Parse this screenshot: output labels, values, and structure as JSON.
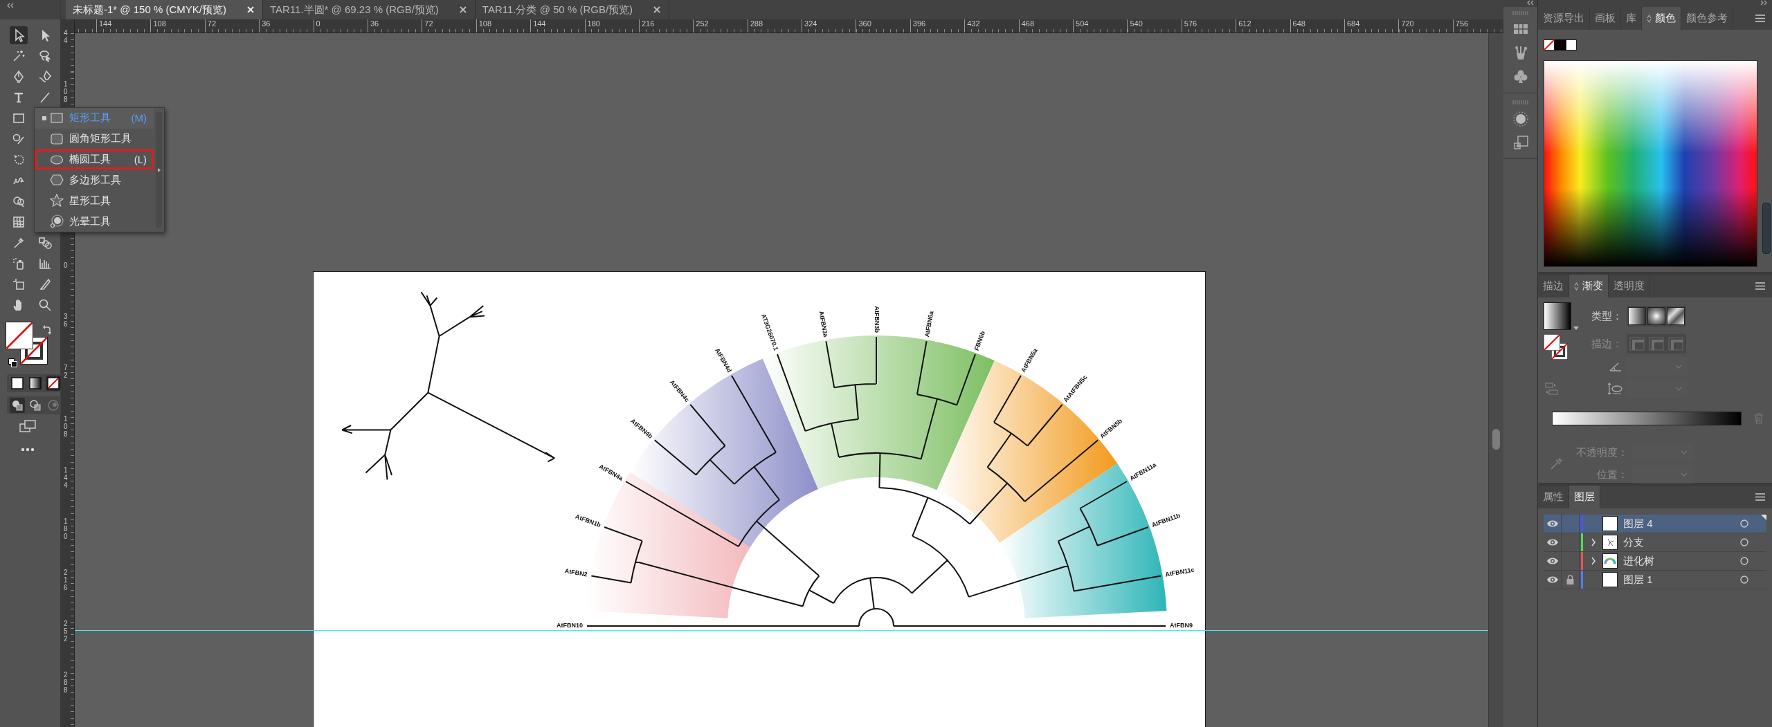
{
  "doc_tabs": [
    {
      "title": "未标题-1* @ 150 % (CMYK/预览)",
      "selected": true
    },
    {
      "title": "TAR11.半圆* @ 69.23 % (RGB/预览)",
      "selected": false
    },
    {
      "title": "TAR11.分类 @ 50 % (RGB/预览)",
      "selected": false
    }
  ],
  "rulers": {
    "horizontal": [
      "144",
      "108",
      "72",
      "36",
      "0",
      "36",
      "72",
      "108",
      "144",
      "180",
      "216",
      "252",
      "288",
      "324",
      "360",
      "396",
      "432",
      "468",
      "504",
      "540",
      "576",
      "612",
      "648",
      "684",
      "720",
      "756"
    ],
    "vertical_above": [
      "44",
      "108"
    ],
    "vertical": [
      "0",
      "36",
      "72",
      "108",
      "144",
      "180",
      "216",
      "252",
      "288"
    ]
  },
  "toolbar": {
    "tool_rows": [
      [
        {
          "kind": "selection",
          "selected": true
        },
        {
          "kind": "direct-selection",
          "selected": false
        }
      ],
      [
        {
          "kind": "magic-wand",
          "selected": false
        },
        {
          "kind": "lasso",
          "selected": false
        }
      ],
      [
        {
          "kind": "pen",
          "selected": false
        },
        {
          "kind": "curvature",
          "selected": false
        }
      ],
      [
        {
          "kind": "type",
          "selected": false
        },
        {
          "kind": "line",
          "selected": false
        }
      ],
      [
        {
          "kind": "rectangle",
          "selected": false
        }
      ],
      [
        {
          "kind": "shaper",
          "selected": false
        }
      ],
      [
        {
          "kind": "rotate",
          "selected": false
        }
      ],
      [
        {
          "kind": "puppet-warp",
          "selected": false
        }
      ],
      [
        {
          "kind": "shape-builder",
          "selected": false
        }
      ],
      [
        {
          "kind": "mesh",
          "selected": false
        }
      ],
      [
        {
          "kind": "eyedropper",
          "selected": false
        },
        {
          "kind": "blend",
          "selected": false
        }
      ],
      [
        {
          "kind": "symbol-sprayer",
          "selected": false
        },
        {
          "kind": "graph",
          "selected": false
        }
      ],
      [
        {
          "kind": "artboard",
          "selected": false
        },
        {
          "kind": "slice",
          "selected": false
        }
      ],
      [
        {
          "kind": "hand",
          "selected": false
        },
        {
          "kind": "zoom",
          "selected": false
        }
      ]
    ],
    "fill_modes": [
      {
        "kind": "color",
        "selected": false
      },
      {
        "kind": "gradient",
        "selected": false
      },
      {
        "kind": "none",
        "selected": true
      }
    ],
    "draw_modes": [
      {
        "kind": "normal",
        "selected": true
      },
      {
        "kind": "behind",
        "selected": false
      },
      {
        "kind": "inside",
        "selected": false
      }
    ]
  },
  "flyout": {
    "items": [
      {
        "kind": "rectangle",
        "label": "矩形工具",
        "shortcut": "(M)",
        "selected": true,
        "highlighted": false
      },
      {
        "kind": "rounded-rectangle",
        "label": "圆角矩形工具",
        "selected": false,
        "highlighted": false
      },
      {
        "kind": "ellipse",
        "label": "椭圆工具",
        "shortcut": "(L)",
        "selected": false,
        "highlighted": true
      },
      {
        "kind": "polygon",
        "label": "多边形工具",
        "selected": false,
        "highlighted": false
      },
      {
        "kind": "star",
        "label": "星形工具",
        "selected": false,
        "highlighted": false
      },
      {
        "kind": "flare",
        "label": "光晕工具",
        "selected": false,
        "highlighted": false
      }
    ]
  },
  "tree": {
    "leaves": [
      "AtFBN10",
      "AtFBN2",
      "AtFBN1b",
      "AtFBN4a",
      "AtFBN4b",
      "AtFBN4c",
      "AtFBN4d",
      "AT3G26070.1",
      "AtFBN3a",
      "AtFBN3b",
      "AtFBN6a",
      "FBN6b",
      "AtFBN5a",
      "AtAtFBN5c",
      "AtFBN5b",
      "AtFBN11a",
      "AtFBN11b",
      "AtFBN11c",
      "AtFBN9"
    ]
  },
  "color_panel": {
    "tabs": [
      {
        "label": "资源导出",
        "selected": false
      },
      {
        "label": "画板",
        "selected": false
      },
      {
        "label": "库",
        "selected": false
      },
      {
        "label": "颜色",
        "selected": true
      },
      {
        "label": "颜色参考",
        "selected": false
      }
    ]
  },
  "gradient_panel": {
    "tabs": [
      {
        "label": "描边",
        "selected": false
      },
      {
        "label": "渐变",
        "selected": true
      },
      {
        "label": "透明度",
        "selected": false
      }
    ],
    "type_label": {
      "text": "类型：",
      "disabled": false
    },
    "stroke_label": {
      "text": "描边：",
      "disabled": true
    },
    "angle_field": {
      "disabled": true
    },
    "aspect_field": {
      "disabled": true
    },
    "opacity_label": {
      "text": "不透明度：",
      "disabled": true
    },
    "location_label": {
      "text": "位置：",
      "disabled": true
    }
  },
  "layers_panel": {
    "tabs": [
      {
        "label": "属性",
        "selected": false
      },
      {
        "label": "图层",
        "selected": true
      }
    ],
    "rows": [
      {
        "name": "图层 4",
        "color": "#5050ff",
        "visible": true,
        "locked": false,
        "expandable": false,
        "selected": true,
        "kind": "blank"
      },
      {
        "name": "分支",
        "color": "#4ee04e",
        "visible": true,
        "locked": false,
        "expandable": true,
        "expanded": false,
        "selected": false,
        "kind": "branches"
      },
      {
        "name": "进化树",
        "color": "#ff4f4f",
        "visible": true,
        "locked": false,
        "expandable": true,
        "expanded": false,
        "selected": false,
        "kind": "tree"
      },
      {
        "name": "图层 1",
        "color": "#4f7fff",
        "visible": true,
        "locked": true,
        "expandable": false,
        "selected": false,
        "kind": "blank"
      }
    ]
  }
}
